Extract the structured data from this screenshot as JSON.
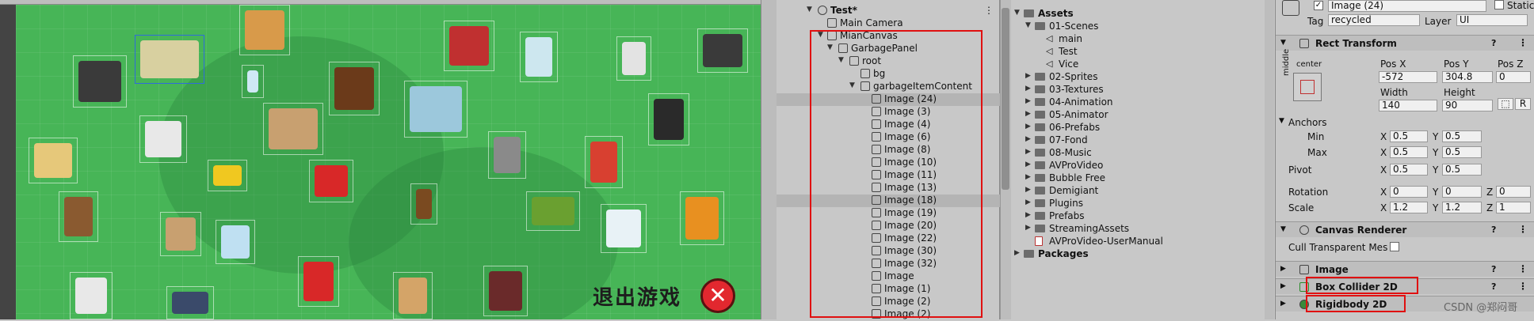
{
  "scene": {
    "exit_label": "退出游戏",
    "exit_icon": "close-x-icon"
  },
  "hierarchy": {
    "rows": [
      {
        "label": "Test*",
        "expanded": true
      },
      {
        "label": "Main Camera"
      },
      {
        "label": "MianCanvas",
        "expanded": true
      },
      {
        "label": "GarbagePanel",
        "expanded": true
      },
      {
        "label": "root",
        "expanded": true
      },
      {
        "label": "bg"
      },
      {
        "label": "garbageItemContent",
        "expanded": true
      },
      {
        "label": "Image (24)",
        "selected": true
      },
      {
        "label": "Image (3)"
      },
      {
        "label": "Image (4)"
      },
      {
        "label": "Image (6)"
      },
      {
        "label": "Image (8)"
      },
      {
        "label": "Image (10)"
      },
      {
        "label": "Image (11)"
      },
      {
        "label": "Image (13)"
      },
      {
        "label": "Image (18)",
        "selected": true
      },
      {
        "label": "Image (19)"
      },
      {
        "label": "Image (20)"
      },
      {
        "label": "Image (22)"
      },
      {
        "label": "Image (30)"
      },
      {
        "label": "Image (32)"
      },
      {
        "label": "Image"
      },
      {
        "label": "Image (1)"
      },
      {
        "label": "Image (2)"
      },
      {
        "label": "Image (2)"
      }
    ],
    "menu_icon": "kebab-menu-icon"
  },
  "project": {
    "rows": [
      {
        "label": "Assets",
        "bold": true
      },
      {
        "label": "01-Scenes"
      },
      {
        "label": "main"
      },
      {
        "label": "Test"
      },
      {
        "label": "Vice"
      },
      {
        "label": "02-Sprites"
      },
      {
        "label": "03-Textures"
      },
      {
        "label": "04-Animation"
      },
      {
        "label": "05-Animator"
      },
      {
        "label": "06-Prefabs"
      },
      {
        "label": "07-Fond"
      },
      {
        "label": "08-Music"
      },
      {
        "label": "AVProVideo"
      },
      {
        "label": "Bubble Free"
      },
      {
        "label": "Demigiant"
      },
      {
        "label": "Plugins"
      },
      {
        "label": "Prefabs"
      },
      {
        "label": "StreamingAssets"
      },
      {
        "label": "AVProVideo-UserManual"
      },
      {
        "label": "Packages",
        "bold": true
      }
    ]
  },
  "inspector": {
    "object_name": "Image (24)",
    "static_label": "Static",
    "tag_label": "Tag",
    "tag_value": "recycled",
    "layer_label": "Layer",
    "layer_value": "UI",
    "rect_transform": {
      "title": "Rect Transform",
      "anchor_preset_top": "center",
      "anchor_preset_side": "middle",
      "pos_x_label": "Pos X",
      "pos_x": "-572",
      "pos_y_label": "Pos Y",
      "pos_y": "304.8",
      "pos_z_label": "Pos Z",
      "pos_z": "0",
      "width_label": "Width",
      "width": "140",
      "height_label": "Height",
      "height": "90",
      "raw_button": "R",
      "anchors_label": "Anchors",
      "min_label": "Min",
      "min_x": "0.5",
      "min_y": "0.5",
      "max_label": "Max",
      "max_x": "0.5",
      "max_y": "0.5",
      "pivot_label": "Pivot",
      "pivot_x": "0.5",
      "pivot_y": "0.5",
      "rotation_label": "Rotation",
      "rot_x": "0",
      "rot_y": "0",
      "rot_z": "0",
      "scale_label": "Scale",
      "scale_x": "1.2",
      "scale_y": "1.2",
      "scale_z": "1",
      "x_letter": "X",
      "y_letter": "Y",
      "z_letter": "Z"
    },
    "canvas_renderer": {
      "title": "Canvas Renderer",
      "cull_label": "Cull Transparent Mes"
    },
    "components": [
      "Image",
      "Box Collider 2D",
      "Rigidbody 2D"
    ]
  },
  "watermark": "CSDN @郑闷哥",
  "colors": {
    "scene_green": "#47b557",
    "highlight_red": "#e01010",
    "panel_gray": "#c8c8c8"
  }
}
